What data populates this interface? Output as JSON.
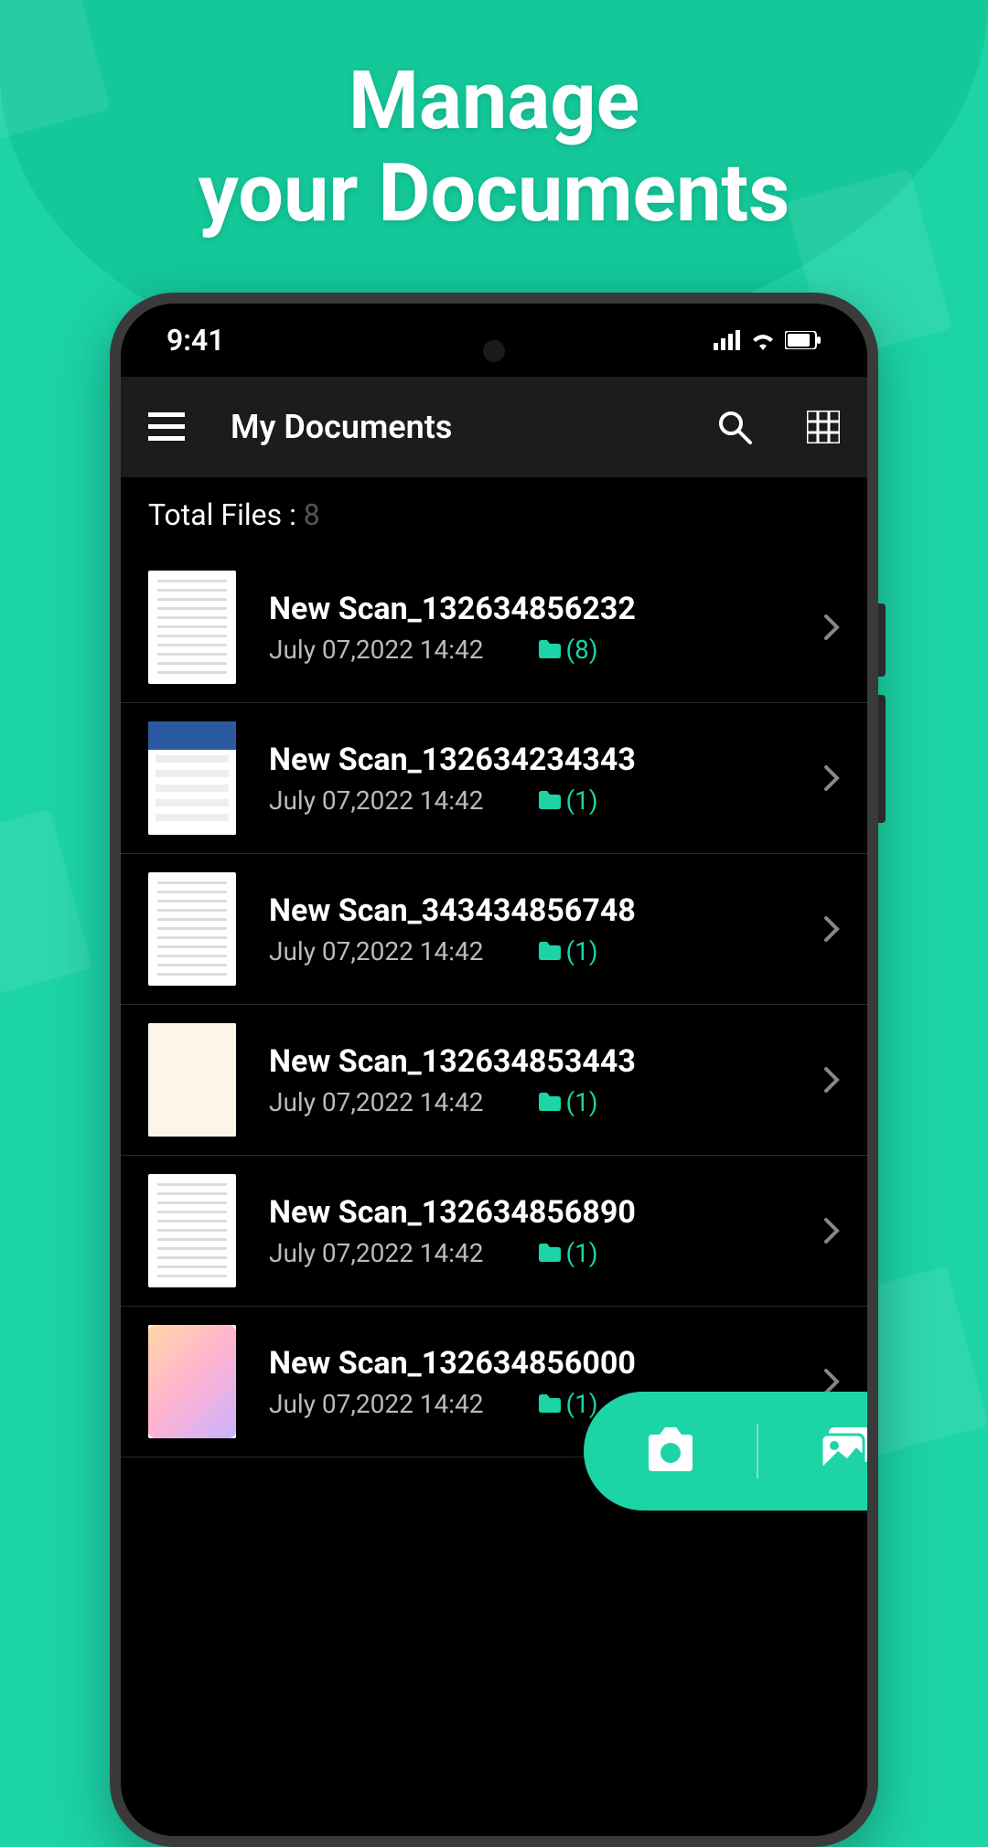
{
  "hero": {
    "line1": "Manage",
    "line2": "your Documents"
  },
  "status": {
    "time": "9:41"
  },
  "header": {
    "title": "My Documents"
  },
  "summary": {
    "label": "Total Files :",
    "count": "8"
  },
  "documents": [
    {
      "title": "New Scan_132634856232",
      "date": "July 07,2022 14:42",
      "folder_count": "(8)"
    },
    {
      "title": "New Scan_132634234343",
      "date": "July 07,2022 14:42",
      "folder_count": "(1)"
    },
    {
      "title": "New Scan_343434856748",
      "date": "July 07,2022 14:42",
      "folder_count": "(1)"
    },
    {
      "title": "New Scan_132634853443",
      "date": "July 07,2022 14:42",
      "folder_count": "(1)"
    },
    {
      "title": "New Scan_132634856890",
      "date": "July 07,2022 14:42",
      "folder_count": "(1)"
    },
    {
      "title": "New Scan_132634856000",
      "date": "July 07,2022 14:42",
      "folder_count": "(1)"
    }
  ]
}
